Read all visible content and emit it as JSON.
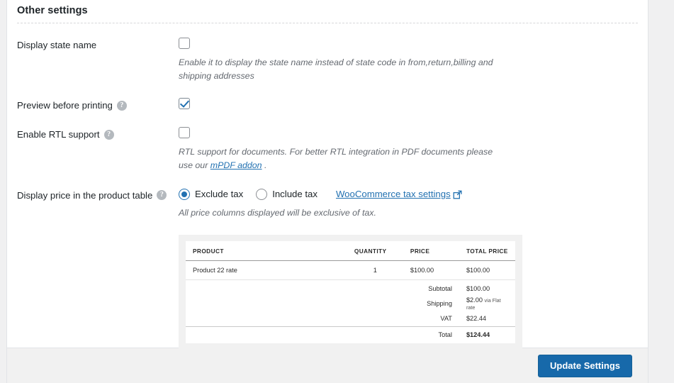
{
  "section": {
    "title": "Other settings"
  },
  "settings": {
    "display_state_name": {
      "label": "Display state name",
      "checked": false,
      "description": "Enable it to display the state name instead of state code in from,return,billing and shipping addresses"
    },
    "preview_before_printing": {
      "label": "Preview before printing",
      "help_icon": "question-mark-icon",
      "checked": true
    },
    "enable_rtl_support": {
      "label": "Enable RTL support",
      "help_icon": "question-mark-icon",
      "checked": false,
      "description_before": "RTL support for documents. For better RTL integration in PDF documents please use our ",
      "link_label": "mPDF addon",
      "description_after": " ."
    },
    "display_price_in_product_table": {
      "label": "Display price in the product table",
      "help_icon": "question-mark-icon",
      "options": [
        {
          "label": "Exclude tax",
          "selected": true
        },
        {
          "label": "Include tax",
          "selected": false
        }
      ],
      "link_label": "WooCommerce tax settings",
      "link_icon": "external-link-icon",
      "description": "All price columns displayed will be exclusive of tax."
    }
  },
  "preview_table": {
    "headers": [
      "PRODUCT",
      "QUANTITY",
      "PRICE",
      "TOTAL PRICE"
    ],
    "rows": [
      {
        "product": "Product 22 rate",
        "quantity": "1",
        "price": "$100.00",
        "total": "$100.00"
      }
    ],
    "totals": [
      {
        "label": "Subtotal",
        "value": "$100.00",
        "note": ""
      },
      {
        "label": "Shipping",
        "value": "$2.00",
        "note": "via Flat rate"
      },
      {
        "label": "VAT",
        "value": "$22.44",
        "note": ""
      }
    ],
    "grand_total": {
      "label": "Total",
      "value": "$124.44"
    }
  },
  "footer": {
    "update_button": "Update Settings"
  },
  "colors": {
    "accent": "#2271b1",
    "button": "#1769aa",
    "link": "#2271b1",
    "help_icon": "#b4b9be",
    "page_bg": "#f0f0f1"
  }
}
